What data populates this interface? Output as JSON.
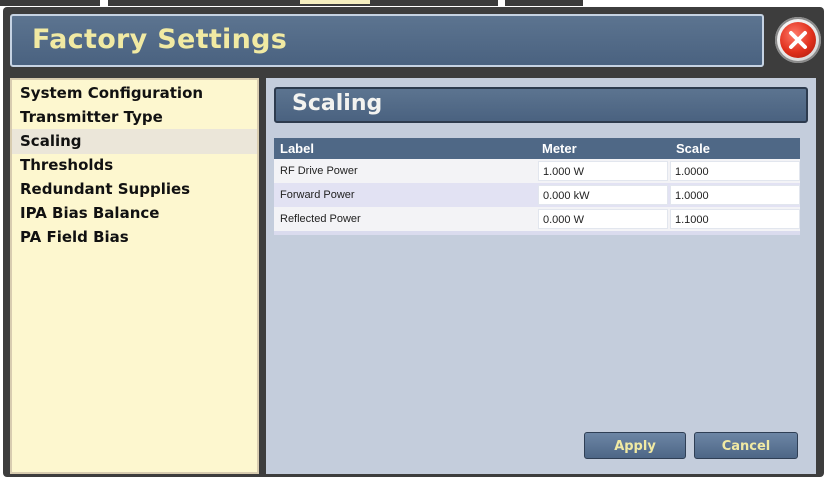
{
  "window": {
    "title": "Factory Settings"
  },
  "sidebar": {
    "items": [
      {
        "label": "System Configuration"
      },
      {
        "label": "Transmitter Type"
      },
      {
        "label": "Scaling"
      },
      {
        "label": "Thresholds"
      },
      {
        "label": "Redundant Supplies"
      },
      {
        "label": "IPA Bias Balance"
      },
      {
        "label": "PA Field Bias"
      }
    ],
    "active_label": "Scaling"
  },
  "main": {
    "section_title": "Scaling",
    "table": {
      "columns": [
        "Label",
        "Meter",
        "Scale"
      ],
      "rows": [
        {
          "label": "RF Drive Power",
          "meter": "1.000 W",
          "scale": "1.0000"
        },
        {
          "label": "Forward Power",
          "meter": "0.000 kW",
          "scale": "1.0000"
        },
        {
          "label": "Reflected Power",
          "meter": "0.000 W",
          "scale": "1.1000"
        }
      ]
    },
    "buttons": {
      "apply": "Apply",
      "cancel": "Cancel"
    }
  },
  "icons": {
    "close": "close-icon"
  },
  "colors": {
    "header_bg": "#4a6280",
    "title_text": "#f1eaa3",
    "sidebar_bg": "#fdf7cf",
    "main_bg": "#c4cddc",
    "close_red": "#e0301c"
  }
}
